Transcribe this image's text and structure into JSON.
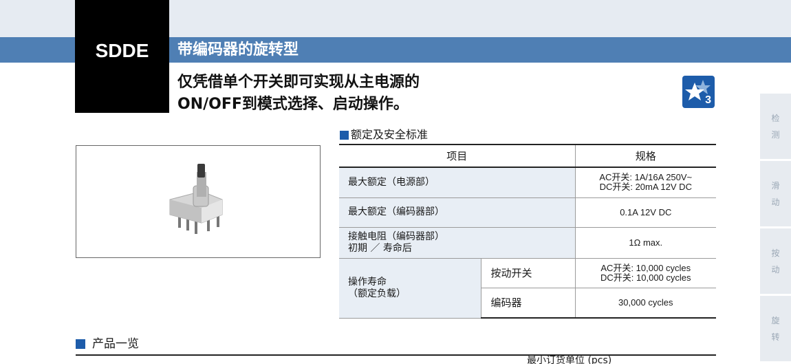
{
  "header": {
    "model_code": "SDDE",
    "series_title": "带编码器的旋转型",
    "headline_line1": "仅凭借单个开关即可实现从主电源的",
    "headline_line2": "ON/OFF到模式选择、启动操作。",
    "badge_number": "3",
    "badge_icon": "stars-icon"
  },
  "colors": {
    "accent_blue": "#1d5caa",
    "band_blue": "#4f7fb4",
    "top_band": "#e6ebf2",
    "item_cell": "#e8eef5"
  },
  "side_tabs": [
    {
      "line1": "检",
      "line2": "测"
    },
    {
      "line1": "滑",
      "line2": "动"
    },
    {
      "line1": "按",
      "line2": "动"
    },
    {
      "line1": "旋",
      "line2": "转"
    }
  ],
  "ratings": {
    "heading": "额定及安全标准",
    "col_item": "项目",
    "col_spec": "规格",
    "rows": [
      {
        "item": "最大额定（电源部）",
        "value_line1": "AC开关: 1A/16A 250V~",
        "value_line2": "DC开关: 20mA 12V DC"
      },
      {
        "item": "最大额定（编码器部）",
        "value_line1": "0.1A 12V DC"
      },
      {
        "item_line1": "接触电阻（编码器部）",
        "item_line2": "初期 ／ 寿命后",
        "value_line1": "1Ω max."
      },
      {
        "item_line1": "操作寿命",
        "item_line2": "（额定负载）",
        "sub1": "按动开关",
        "sub1_value_line1": "AC开关: 10,000 cycles",
        "sub1_value_line2": "DC开关: 10,000 cycles",
        "sub2": "编码器",
        "sub2_value": "30,000 cycles"
      }
    ]
  },
  "products": {
    "heading": "产品一览",
    "visible_column": "最小订货单位 (pcs)"
  }
}
